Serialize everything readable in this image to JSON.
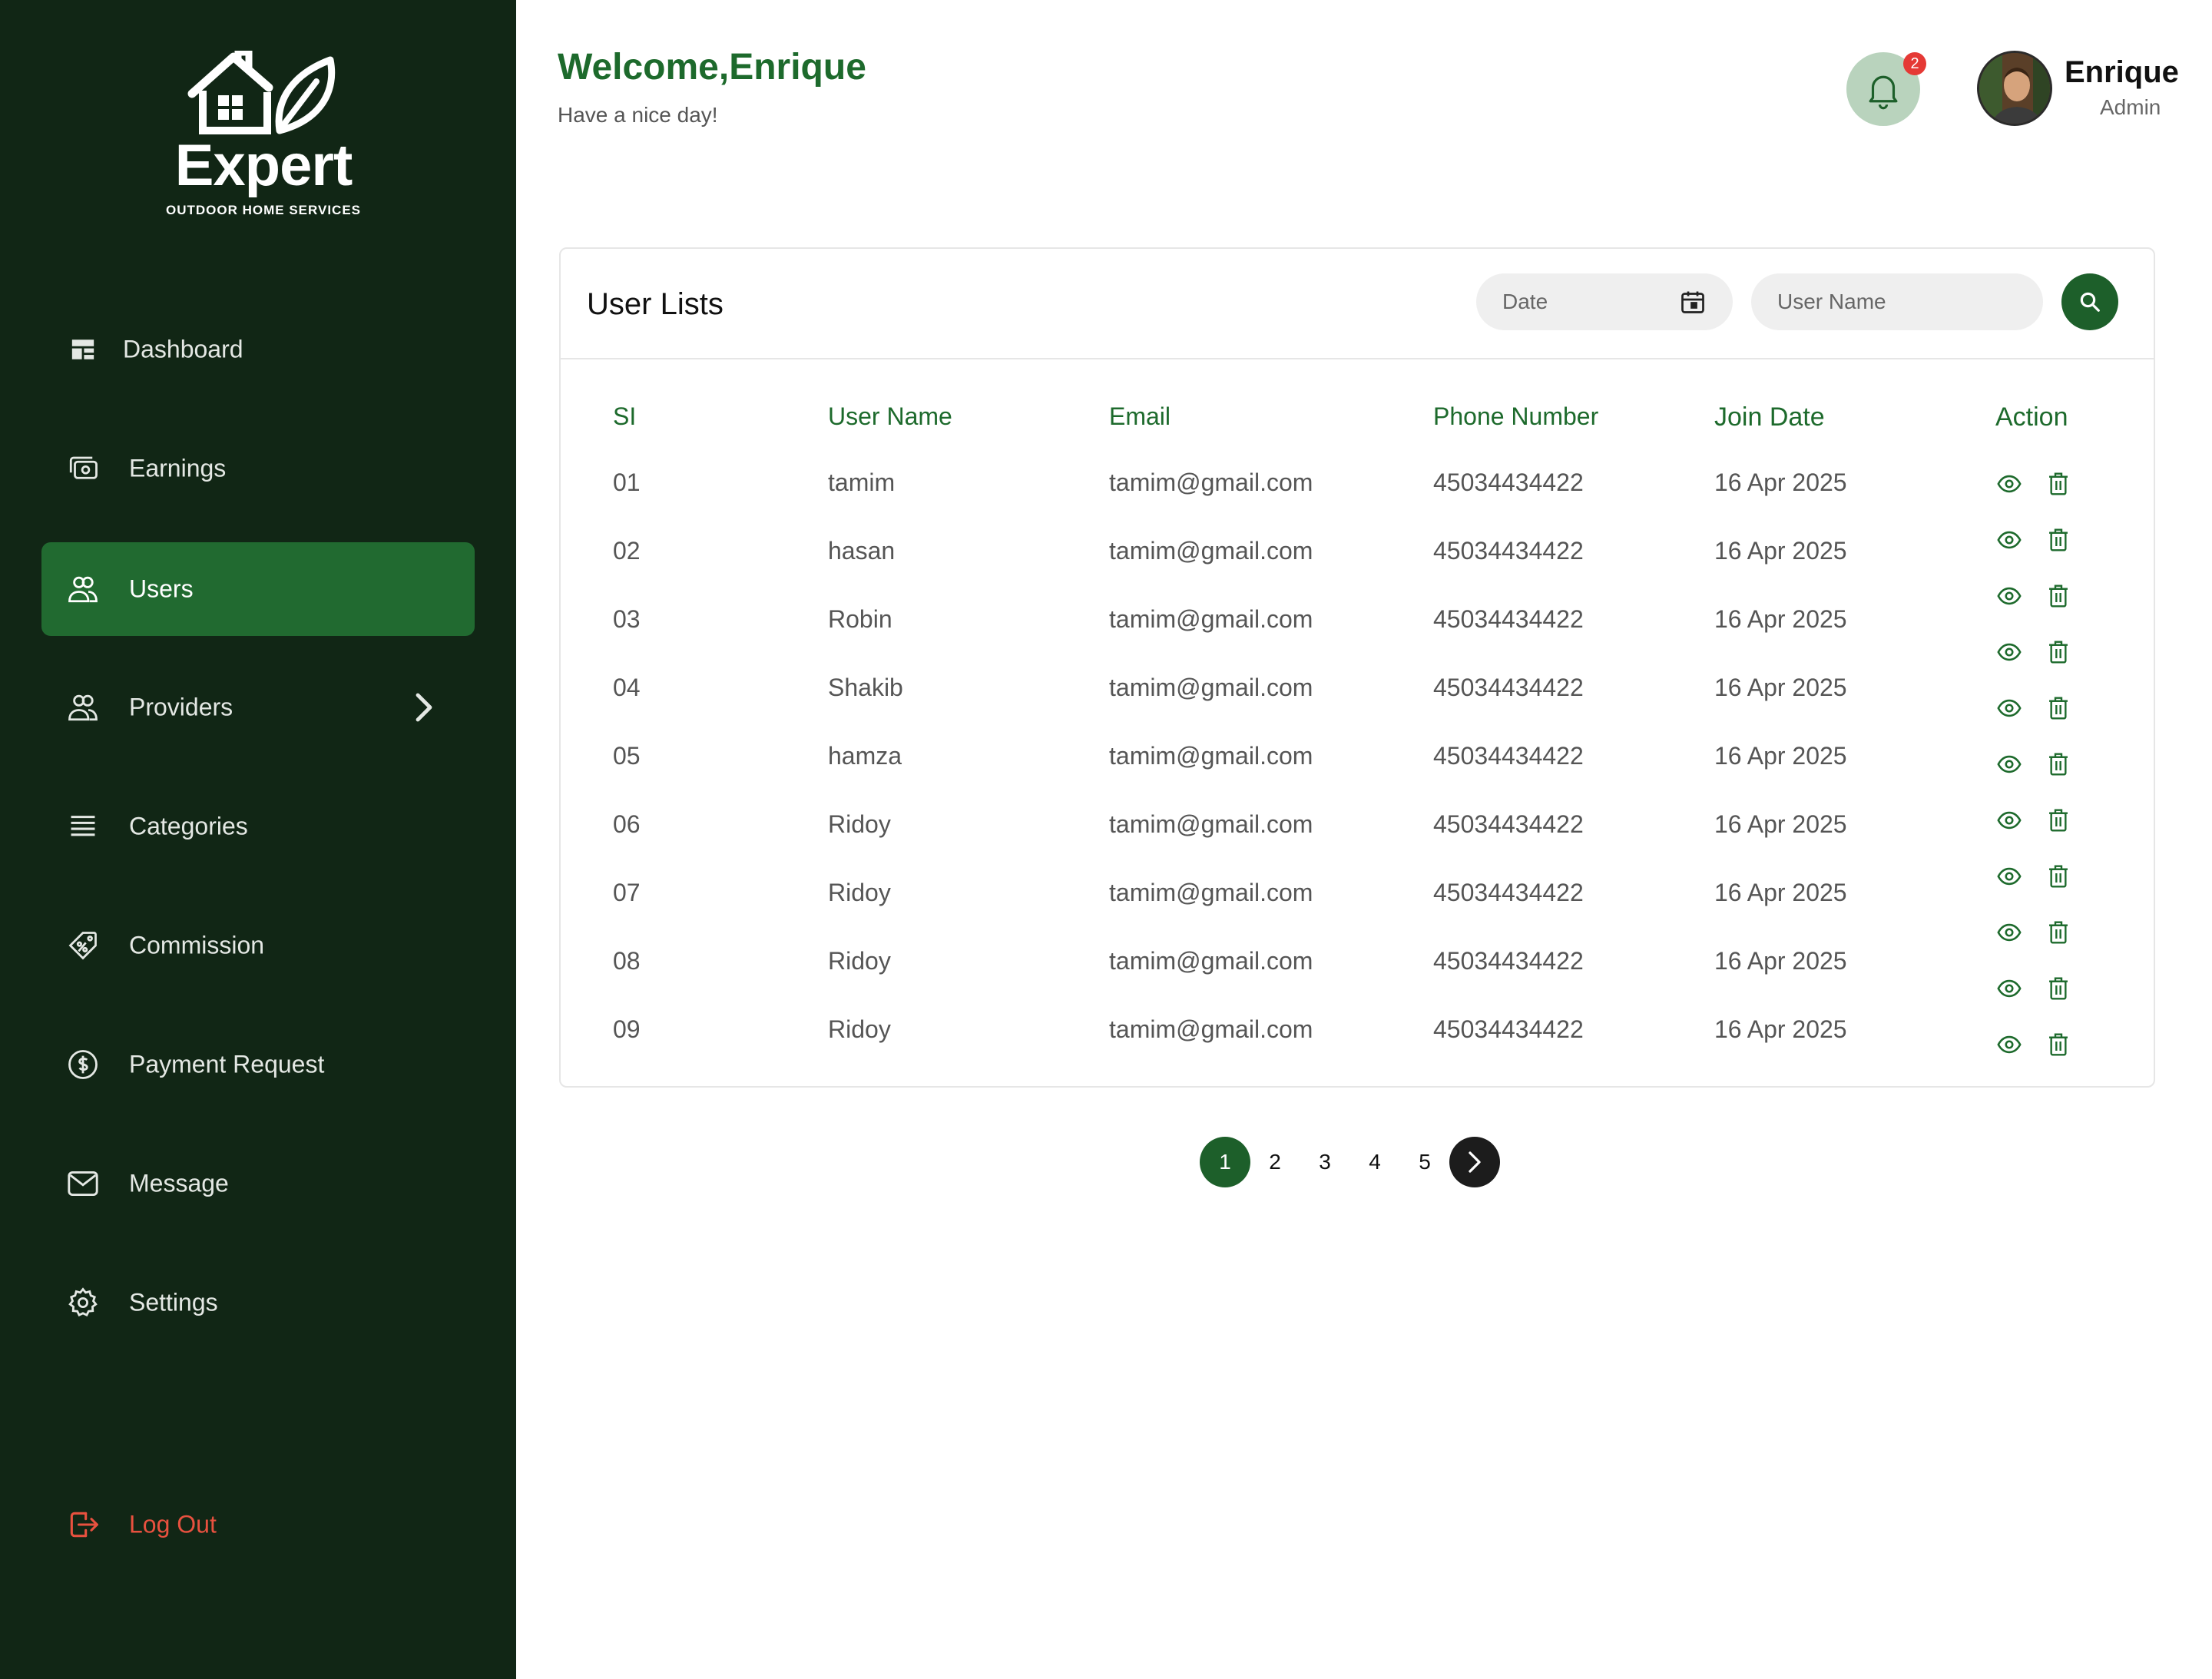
{
  "brand": {
    "name": "Expert",
    "tagline": "OUTDOOR HOME SERVICES"
  },
  "sidebar": {
    "items": [
      {
        "label": "Dashboard",
        "icon": "dashboard-icon"
      },
      {
        "label": "Earnings",
        "icon": "earnings-icon"
      },
      {
        "label": "Users",
        "icon": "users-icon",
        "active": true
      },
      {
        "label": "Providers",
        "icon": "providers-icon",
        "has_submenu": true
      },
      {
        "label": "Categories",
        "icon": "categories-icon"
      },
      {
        "label": "Commission",
        "icon": "commission-icon"
      },
      {
        "label": "Payment Request",
        "icon": "payment-icon"
      },
      {
        "label": "Message",
        "icon": "message-icon"
      },
      {
        "label": "Settings",
        "icon": "settings-icon"
      }
    ],
    "logout_label": "Log Out"
  },
  "header": {
    "welcome": "Welcome,Enrique",
    "subtitle": "Have a nice day!",
    "notification_count": "2",
    "profile": {
      "name": "Enrique",
      "role": "Admin"
    }
  },
  "card": {
    "title": "User Lists",
    "date_placeholder": "Date",
    "username_placeholder": "User Name"
  },
  "table": {
    "headers": [
      "SI",
      "User Name",
      "Email",
      "Phone Number",
      "Join Date",
      "Action"
    ],
    "rows": [
      {
        "si": "01",
        "name": "tamim",
        "email": "tamim@gmail.com",
        "phone": "45034434422",
        "date": "16 Apr 2025"
      },
      {
        "si": "02",
        "name": "hasan",
        "email": "tamim@gmail.com",
        "phone": "45034434422",
        "date": "16 Apr 2025"
      },
      {
        "si": "03",
        "name": "Robin",
        "email": "tamim@gmail.com",
        "phone": "45034434422",
        "date": "16 Apr 2025"
      },
      {
        "si": "04",
        "name": "Shakib",
        "email": "tamim@gmail.com",
        "phone": "45034434422",
        "date": "16 Apr 2025"
      },
      {
        "si": "05",
        "name": "hamza",
        "email": "tamim@gmail.com",
        "phone": "45034434422",
        "date": "16 Apr 2025"
      },
      {
        "si": "06",
        "name": "Ridoy",
        "email": "tamim@gmail.com",
        "phone": "45034434422",
        "date": "16 Apr 2025"
      },
      {
        "si": "07",
        "name": "Ridoy",
        "email": "tamim@gmail.com",
        "phone": "45034434422",
        "date": "16 Apr 2025"
      },
      {
        "si": "08",
        "name": "Ridoy",
        "email": "tamim@gmail.com",
        "phone": "45034434422",
        "date": "16 Apr 2025"
      },
      {
        "si": "09",
        "name": "Ridoy",
        "email": "tamim@gmail.com",
        "phone": "45034434422",
        "date": "16 Apr 2025"
      }
    ],
    "action_icon_rows": 11
  },
  "pagination": {
    "pages": [
      "1",
      "2",
      "3",
      "4",
      "5"
    ],
    "current": "1"
  },
  "colors": {
    "sidebar_bg": "#112615",
    "accent": "#1d6a2c",
    "active_item": "#216a30",
    "logout": "#e8513f",
    "badge": "#e53935"
  }
}
